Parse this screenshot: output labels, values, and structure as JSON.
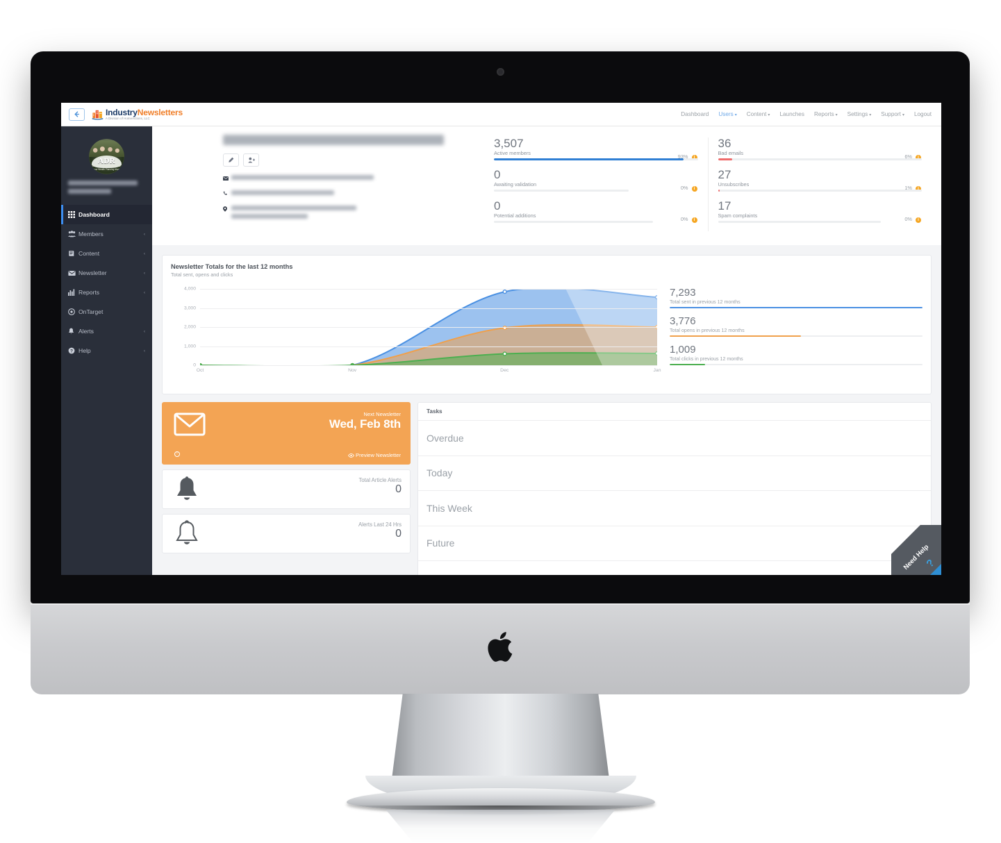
{
  "device": {
    "brand_logo": "apple-logo"
  },
  "browser": {
    "back_button": "back-arrow-icon"
  },
  "logo": {
    "word1": "Industry",
    "word2": "Newsletters",
    "tagline": "A Division of HomeActions, LLC",
    "color_word1": "#1b3a66",
    "color_word2": "#f07f2a"
  },
  "topnav": {
    "items": [
      {
        "label": "Dashboard",
        "active": false,
        "caret": false
      },
      {
        "label": "Users",
        "active": true,
        "caret": true
      },
      {
        "label": "Content",
        "active": false,
        "caret": true
      },
      {
        "label": "Launches",
        "active": false,
        "caret": false
      },
      {
        "label": "Reports",
        "active": false,
        "caret": true
      },
      {
        "label": "Settings",
        "active": false,
        "caret": true
      },
      {
        "label": "Support",
        "active": false,
        "caret": true
      },
      {
        "label": "Logout",
        "active": false,
        "caret": false
      }
    ]
  },
  "sidebar": {
    "avatar": {
      "initials": "ADR",
      "subtext": "Anderson Dorn & Rader, Ltd.\nand Wealth Planning Attys"
    },
    "org_name_redacted": true,
    "items": [
      {
        "label": "Dashboard",
        "icon": "grid-icon",
        "chevron": false,
        "active": true
      },
      {
        "label": "Members",
        "icon": "people-icon",
        "chevron": true,
        "active": false
      },
      {
        "label": "Content",
        "icon": "book-icon",
        "chevron": true,
        "active": false
      },
      {
        "label": "Newsletter",
        "icon": "envelope-icon",
        "chevron": true,
        "active": false
      },
      {
        "label": "Reports",
        "icon": "bar-chart-icon",
        "chevron": true,
        "active": false
      },
      {
        "label": "OnTarget",
        "icon": "target-icon",
        "chevron": false,
        "active": false
      },
      {
        "label": "Alerts",
        "icon": "bell-icon",
        "chevron": true,
        "active": false
      },
      {
        "label": "Help",
        "icon": "question-icon",
        "chevron": true,
        "active": false
      }
    ]
  },
  "profile": {
    "name_redacted": true,
    "buttons": [
      {
        "name": "edit-profile-button",
        "icon": "pencil-icon"
      },
      {
        "name": "add-user-button",
        "icon": "user-plus-icon"
      }
    ],
    "contact_rows": [
      {
        "icon": "envelope-icon",
        "redacted": true
      },
      {
        "icon": "phone-icon",
        "redacted": true
      },
      {
        "icon": "map-pin-icon",
        "redacted": true
      }
    ]
  },
  "stats": {
    "left": [
      {
        "value": "3,507",
        "label": "Active members",
        "percent": "93%",
        "fill": 0.93,
        "color": "#2f7fd4"
      },
      {
        "value": "0",
        "label": "Awaiting validation",
        "percent": "0%",
        "fill": 0.0,
        "color": "#2f7fd4"
      },
      {
        "value": "0",
        "label": "Potential additions",
        "percent": "0%",
        "fill": 0.0,
        "color": "#2f7fd4"
      }
    ],
    "right": [
      {
        "value": "36",
        "label": "Bad emails",
        "percent": "6%",
        "fill": 0.17,
        "color": "#ef6b6b"
      },
      {
        "value": "27",
        "label": "Unsubscribes",
        "percent": "1%",
        "fill": 0.01,
        "color": "#ef6b6b"
      },
      {
        "value": "17",
        "label": "Spam complaints",
        "percent": "0%",
        "fill": 0.0,
        "color": "#ef6b6b"
      }
    ]
  },
  "chart_data": {
    "type": "area",
    "title": "Newsletter Totals for the last 12 months",
    "subtitle": "Total sent, opens and clicks",
    "categories": [
      "Oct",
      "Nov",
      "Dec",
      "Jan"
    ],
    "series": [
      {
        "name": "Total sent",
        "values": [
          0,
          0,
          3850,
          3560
        ],
        "color": "#4a90e2"
      },
      {
        "name": "Total opens",
        "values": [
          0,
          0,
          1960,
          2000
        ],
        "color": "#f0a04b"
      },
      {
        "name": "Total clicks",
        "values": [
          0,
          0,
          600,
          620
        ],
        "color": "#4caf50"
      }
    ],
    "yticks": [
      "0",
      "1,000",
      "2,000",
      "3,000",
      "4,000"
    ],
    "ylim": [
      0,
      4000
    ],
    "xlabel": "",
    "ylabel": "",
    "grid": true,
    "legend_position": "right"
  },
  "chart_legend": [
    {
      "value": "7,293",
      "label": "Total sent in previous 12 months",
      "fill": 1.0,
      "color": "#4a90e2"
    },
    {
      "value": "3,776",
      "label": "Total opens in previous 12 months",
      "fill": 0.52,
      "color": "#f0a04b"
    },
    {
      "value": "1,009",
      "label": "Total clicks in previous 12 months",
      "fill": 0.14,
      "color": "#4caf50"
    }
  ],
  "next_newsletter": {
    "icon": "envelope-icon",
    "label": "Next Newsletter",
    "date": "Wed, Feb 8th",
    "preview_label": "Preview Newsletter",
    "preview_icon": "eye-icon",
    "info_icon": "clock-icon",
    "color": "#f3a454"
  },
  "alert_cards": [
    {
      "icon": "bell-filled-icon",
      "title": "Total Article Alerts",
      "value": "0"
    },
    {
      "icon": "bell-outline-icon",
      "title": "Alerts Last 24 Hrs",
      "value": "0"
    }
  ],
  "tasks": {
    "header": "Tasks",
    "rows": [
      "Overdue",
      "Today",
      "This Week",
      "Future"
    ]
  },
  "need_help": {
    "label": "Need Help",
    "glyph": "?",
    "color": "#555a61",
    "accent": "#2f8fd4"
  }
}
